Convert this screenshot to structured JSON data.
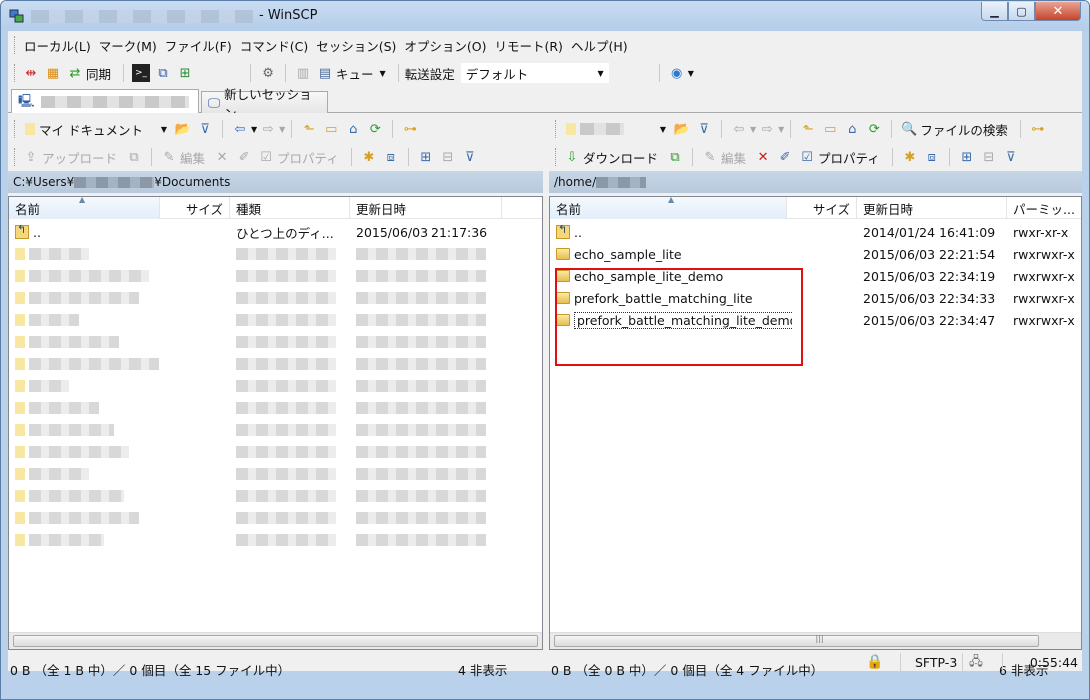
{
  "window": {
    "title": "- WinSCP"
  },
  "menu": [
    "ローカル(L)",
    "マーク(M)",
    "ファイル(F)",
    "コマンド(C)",
    "セッション(S)",
    "オプション(O)",
    "リモート(R)",
    "ヘルプ(H)"
  ],
  "toolbar": {
    "sync_label": "同期",
    "queue_label": "キュー",
    "transfer_label": "転送設定",
    "transfer_value": "デフォルト"
  },
  "tabs": {
    "new_session": "新しいセッション"
  },
  "left": {
    "location": "マイ ドキュメント",
    "upload": "アップロード",
    "edit": "編集",
    "properties": "プロパティ",
    "path_prefix": "C:¥Users¥",
    "path_suffix": "¥Documents",
    "columns": {
      "name": "名前",
      "size": "サイズ",
      "type": "種類",
      "modified": "更新日時"
    },
    "parent": {
      "name": "..",
      "type": "ひとつ上のディ...",
      "date": "2015/06/03",
      "time": "21:17:36"
    },
    "status": "0 B （全 1 B 中）／ 0 個目（全 15 ファイル中）",
    "hidden": "4 非表示"
  },
  "right": {
    "find_label": "ファイルの検索",
    "download": "ダウンロード",
    "edit": "編集",
    "properties": "プロパティ",
    "path": "/home/",
    "columns": {
      "name": "名前",
      "size": "サイズ",
      "modified": "更新日時",
      "perm": "パーミッ..."
    },
    "rows": [
      {
        "name": "..",
        "modified": "2014/01/24 16:41:09",
        "perm": "rwxr-xr-x"
      },
      {
        "name": "echo_sample_lite",
        "modified": "2015/06/03 22:21:54",
        "perm": "rwxrwxr-x"
      },
      {
        "name": "echo_sample_lite_demo",
        "modified": "2015/06/03 22:34:19",
        "perm": "rwxrwxr-x"
      },
      {
        "name": "prefork_battle_matching_lite",
        "modified": "2015/06/03 22:34:33",
        "perm": "rwxrwxr-x"
      },
      {
        "name": "prefork_battle_matching_lite_demo",
        "modified": "2015/06/03 22:34:47",
        "perm": "rwxrwxr-x"
      }
    ],
    "status": "0 B （全 0 B 中）／ 0 個目（全 4 ファイル中）",
    "hidden": "6 非表示"
  },
  "statusbar": {
    "protocol": "SFTP-3",
    "time": "0:55:44"
  },
  "colors": {
    "highlight": "#e01010",
    "pathbar": "#c7d6e6",
    "titlebar": "#b9d1ea"
  }
}
